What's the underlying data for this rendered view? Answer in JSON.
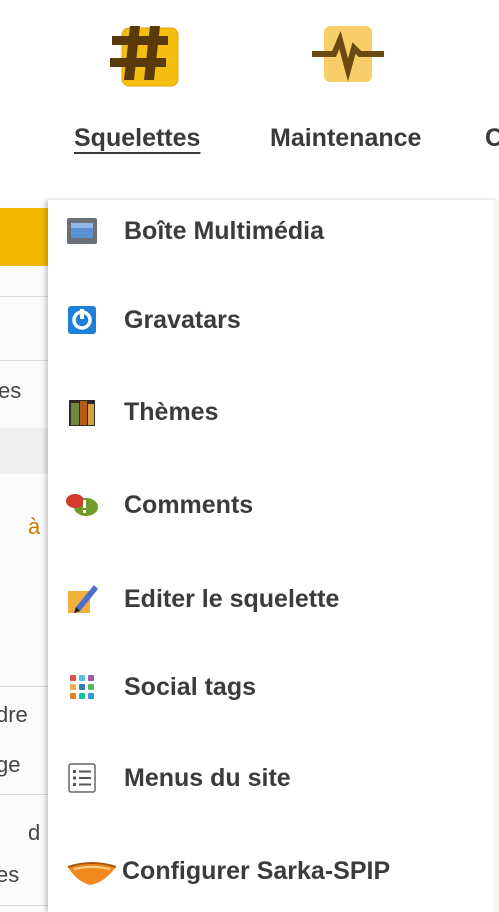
{
  "topnav": {
    "items": [
      {
        "label": "Squelettes",
        "icon": "hash-icon",
        "active": true
      },
      {
        "label": "Maintenance",
        "icon": "pulse-icon",
        "active": false
      },
      {
        "label": "C",
        "icon": "",
        "active": false
      }
    ]
  },
  "background_page": {
    "fragments": [
      "es",
      "à",
      "dre",
      "ge",
      "d",
      "es"
    ]
  },
  "menu": {
    "items": [
      {
        "label": "Boîte Multimédia",
        "icon": "media-box-icon"
      },
      {
        "label": "Gravatars",
        "icon": "gravatar-icon"
      },
      {
        "label": "Thèmes",
        "icon": "themes-icon"
      },
      {
        "label": "Comments",
        "icon": "comments-icon"
      },
      {
        "label": "Editer le squelette",
        "icon": "edit-skeleton-icon"
      },
      {
        "label": "Social tags",
        "icon": "social-tags-icon"
      },
      {
        "label": "Menus du site",
        "icon": "site-menu-icon"
      },
      {
        "label": "Configurer Sarka-SPIP",
        "icon": "sarka-spip-icon"
      }
    ]
  },
  "colors": {
    "accent_orange": "#f5b800",
    "text_dark": "#3b3b3b"
  }
}
